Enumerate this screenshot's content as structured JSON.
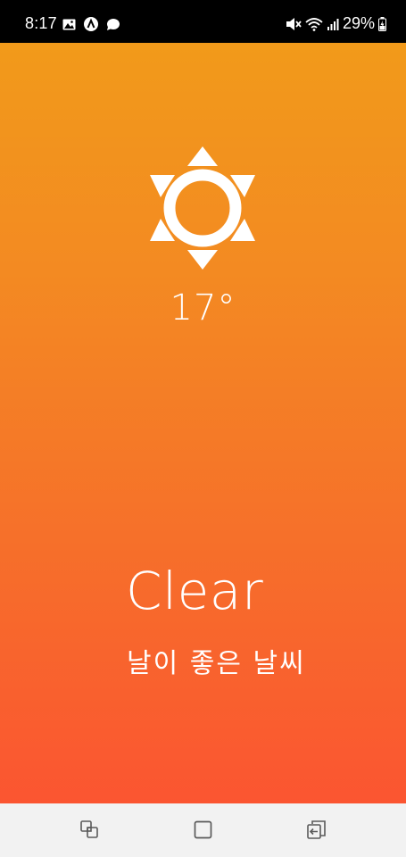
{
  "status_bar": {
    "time": "8:17",
    "battery_percent": "29%",
    "left_icons": [
      "gallery-icon",
      "app-a-icon",
      "chat-bubble-icon"
    ],
    "right_icons": [
      "mute-icon",
      "wifi-icon",
      "signal-icon",
      "battery-charging-icon"
    ]
  },
  "weather": {
    "icon": "sun-icon",
    "temperature": "17°",
    "condition": "Clear",
    "description": "날이 좋은 날씨",
    "gradient_top": "#f29a1a",
    "gradient_bottom": "#fb5531"
  },
  "nav_bar": {
    "buttons": [
      "recents-icon",
      "home-icon",
      "back-icon"
    ]
  }
}
